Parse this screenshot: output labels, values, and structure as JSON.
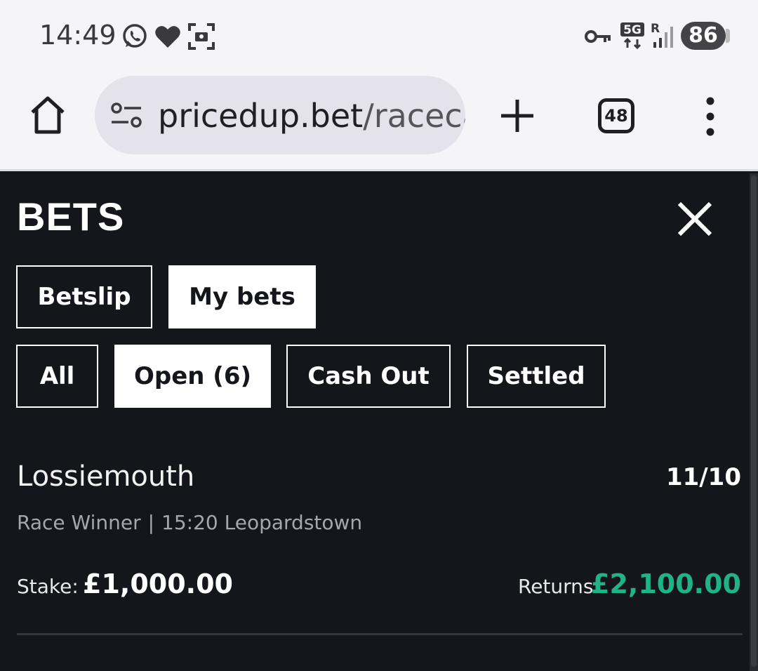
{
  "status_bar": {
    "time": "14:49",
    "icons": [
      "whatsapp-icon",
      "heart-icon",
      "screenshot-icon",
      "vpn-key-icon",
      "5g-data-icon",
      "signal-icon"
    ],
    "network": "5G",
    "roaming": "R",
    "battery": "86"
  },
  "browser": {
    "url_host": "pricedup.bet",
    "url_path": "/raceca",
    "tab_count": "48"
  },
  "panel": {
    "title": "BETS",
    "primary_tabs": [
      {
        "label": "Betslip",
        "active": false
      },
      {
        "label": "My bets",
        "active": true
      }
    ],
    "filter_tabs": [
      {
        "label": "All",
        "active": false
      },
      {
        "label": "Open (6)",
        "active": true
      },
      {
        "label": "Cash Out",
        "active": false
      },
      {
        "label": "Settled",
        "active": false
      }
    ]
  },
  "bet": {
    "selection": "Lossiemouth",
    "odds": "11/10",
    "market": "Race Winner",
    "separator": "|",
    "event": "15:20 Leopardstown",
    "stake_label": "Stake:",
    "stake": "£1,000.00",
    "returns_label": "Returns:",
    "returns": "£2,100.00"
  },
  "colors": {
    "panel_bg": "#15161b",
    "returns_accent": "#20b388",
    "browser_bg": "#f4f4f9"
  }
}
